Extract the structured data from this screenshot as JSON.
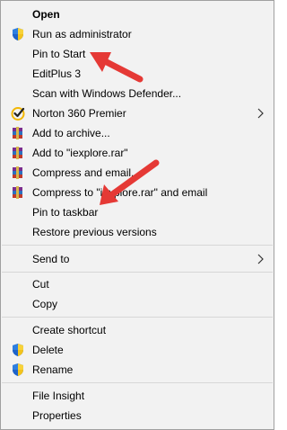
{
  "context_menu": {
    "items": [
      {
        "label": "Open",
        "bold": true
      },
      {
        "label": "Run as administrator",
        "icon": "shield-icon"
      },
      {
        "label": "Pin to Start"
      },
      {
        "label": "EditPlus 3"
      },
      {
        "label": "Scan with Windows Defender..."
      },
      {
        "label": "Norton 360 Premier",
        "icon": "norton-checkmark-icon",
        "submenu": true
      },
      {
        "label": "Add to archive...",
        "icon": "winrar-books-icon"
      },
      {
        "label": "Add to \"iexplore.rar\"",
        "icon": "winrar-books-icon"
      },
      {
        "label": "Compress and email...",
        "icon": "winrar-books-icon"
      },
      {
        "label": "Compress to \"iexplore.rar\" and email",
        "icon": "winrar-books-icon"
      },
      {
        "label": "Pin to taskbar"
      },
      {
        "label": "Restore previous versions"
      },
      {
        "label": "Send to",
        "submenu": true
      },
      {
        "label": "Cut"
      },
      {
        "label": "Copy"
      },
      {
        "label": "Create shortcut"
      },
      {
        "label": "Delete",
        "icon": "shield-icon"
      },
      {
        "label": "Rename",
        "icon": "shield-icon"
      },
      {
        "label": "File Insight"
      },
      {
        "label": "Properties"
      }
    ]
  },
  "annotations": {
    "arrow_color": "#e53935",
    "arrows": [
      {
        "points_to": "Pin to Start"
      },
      {
        "points_to": "Pin to taskbar"
      }
    ]
  },
  "colors": {
    "menu_background": "#f2f2f2",
    "menu_border": "#a0a0a0",
    "separator": "#d7d7d7"
  }
}
